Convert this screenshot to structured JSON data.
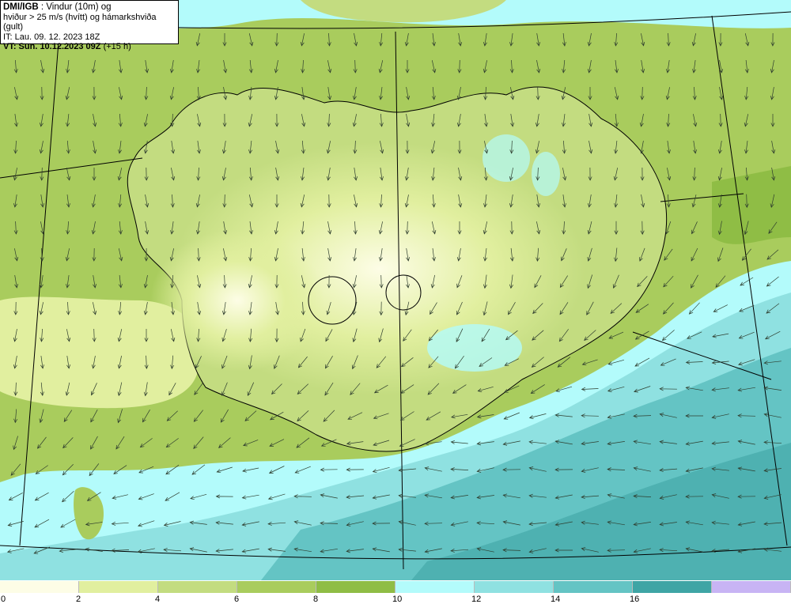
{
  "header": {
    "source": "DMI/IGB",
    "title_rest": " : Vindur (10m) og",
    "line2": "hviður > 25 m/s (hvítt) og hámarkshviða (gult)",
    "issue_time": "IT: Lau. 09. 12. 2023 18Z",
    "valid_time": "VT: Sun. 10.12.2023 09Z",
    "lead_time": " (+15 h)"
  },
  "legend": {
    "ticks": [
      "0",
      "2",
      "4",
      "6",
      "8",
      "10",
      "12",
      "14",
      "16"
    ],
    "colors": [
      "#fdfde6",
      "#e1ef9f",
      "#c3dc80",
      "#a9cc5d",
      "#8fbd45",
      "#b3fbfb",
      "#8fe1e1",
      "#64c4c4",
      "#3fa5a5",
      "#c8b4f4"
    ]
  },
  "map": {
    "sea_color": "#82d6d6",
    "land_color": "#a9cc5d",
    "coast_color": "#000000",
    "arrow_color": "#2e3d2e"
  }
}
